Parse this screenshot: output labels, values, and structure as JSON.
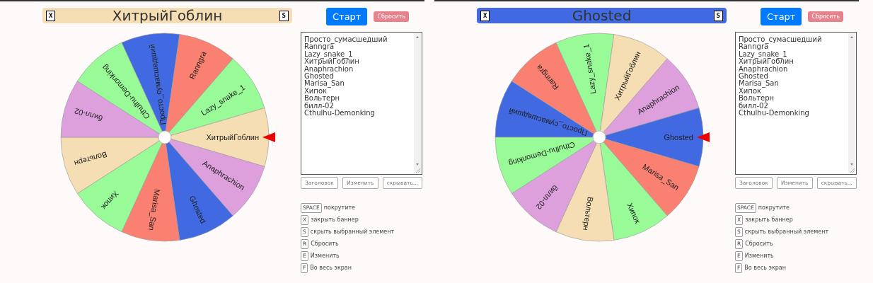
{
  "panels": [
    {
      "banner": {
        "close_key": "X",
        "title": "ХитрыйГоблин",
        "hide_key": "S"
      },
      "start_button": "Старт",
      "reset_button": "Сбросить",
      "segments": [
        {
          "label": "Просто_сумасшедший",
          "color": "#4169e1",
          "selected": false
        },
        {
          "label": "Ranngra",
          "color": "#fa8072",
          "selected": false
        },
        {
          "label": "Lazy_snake_1",
          "color": "#98fb98",
          "selected": false
        },
        {
          "label": "ХитрыйГоблин",
          "color": "#f5deb3",
          "selected": true
        },
        {
          "label": "Anaphrachion",
          "color": "#dda0dd",
          "selected": false
        },
        {
          "label": "Ghosted",
          "color": "#4169e1",
          "selected": false
        },
        {
          "label": "Marisa_San",
          "color": "#fa8072",
          "selected": false
        },
        {
          "label": "Хипок",
          "color": "#98fb98",
          "selected": false
        },
        {
          "label": "Вольтерн",
          "color": "#f5deb3",
          "selected": false
        },
        {
          "label": "билл-02",
          "color": "#dda0dd",
          "selected": false
        },
        {
          "label": "Cthulhu-Demonking",
          "color": "#98fb98",
          "selected": false
        }
      ],
      "entries": [
        "Просто_сумасшедший",
        "Ranngra",
        "Lazy_snake_1",
        "ХитрыйГоблин",
        "Anaphrachion",
        "Ghosted",
        "Marisa_San",
        "Хипок",
        "Вольтерн",
        "билл-02",
        "Cthulhu-Demonking"
      ],
      "actions": [
        "Заголовок",
        "Изменить",
        "скрывать..."
      ],
      "shortcuts": [
        {
          "key": "SPACE",
          "text": "покрутите"
        },
        {
          "key": "X",
          "text": "закрыть баннер"
        },
        {
          "key": "S",
          "text": "скрыть выбранный элемент"
        },
        {
          "key": "R",
          "text": "Сбросить"
        },
        {
          "key": "E",
          "text": "Изменить"
        },
        {
          "key": "F",
          "text": "Во весь экран"
        }
      ]
    },
    {
      "banner": {
        "close_key": "X",
        "title": "Ghosted",
        "hide_key": "S"
      },
      "start_button": "Старт",
      "reset_button": "Сбросить",
      "segments": [
        {
          "label": "Просто_сумасшедший",
          "color": "#4169e1",
          "selected": false
        },
        {
          "label": "Ranngra",
          "color": "#fa8072",
          "selected": false
        },
        {
          "label": "Lazy_snake_1",
          "color": "#98fb98",
          "selected": false
        },
        {
          "label": "ХитрыйГоблин",
          "color": "#f5deb3",
          "selected": false
        },
        {
          "label": "Anaphrachion",
          "color": "#dda0dd",
          "selected": false
        },
        {
          "label": "Ghosted",
          "color": "#4169e1",
          "selected": true
        },
        {
          "label": "Marisa_San",
          "color": "#fa8072",
          "selected": false
        },
        {
          "label": "Хипок",
          "color": "#98fb98",
          "selected": false
        },
        {
          "label": "Вольтерн",
          "color": "#f5deb3",
          "selected": false
        },
        {
          "label": "билл-02",
          "color": "#dda0dd",
          "selected": false
        },
        {
          "label": "Cthulhu-Demonking",
          "color": "#98fb98",
          "selected": false
        }
      ],
      "entries": [
        "Просто_сумасшедший",
        "Ranngra",
        "Lazy_snake_1",
        "ХитрыйГоблин",
        "Anaphrachion",
        "Ghosted",
        "Marisa_San",
        "Хипок",
        "Вольтерн",
        "билл-02",
        "Cthulhu-Demonking"
      ],
      "actions": [
        "Заголовок",
        "Изменить",
        "скрывать..."
      ],
      "shortcuts": [
        {
          "key": "SPACE",
          "text": "покрутите"
        },
        {
          "key": "X",
          "text": "закрыть баннер"
        },
        {
          "key": "S",
          "text": "скрыть выбранный элемент"
        },
        {
          "key": "R",
          "text": "Сбросить"
        },
        {
          "key": "E",
          "text": "Изменить"
        },
        {
          "key": "F",
          "text": "Во весь экран"
        }
      ]
    }
  ]
}
